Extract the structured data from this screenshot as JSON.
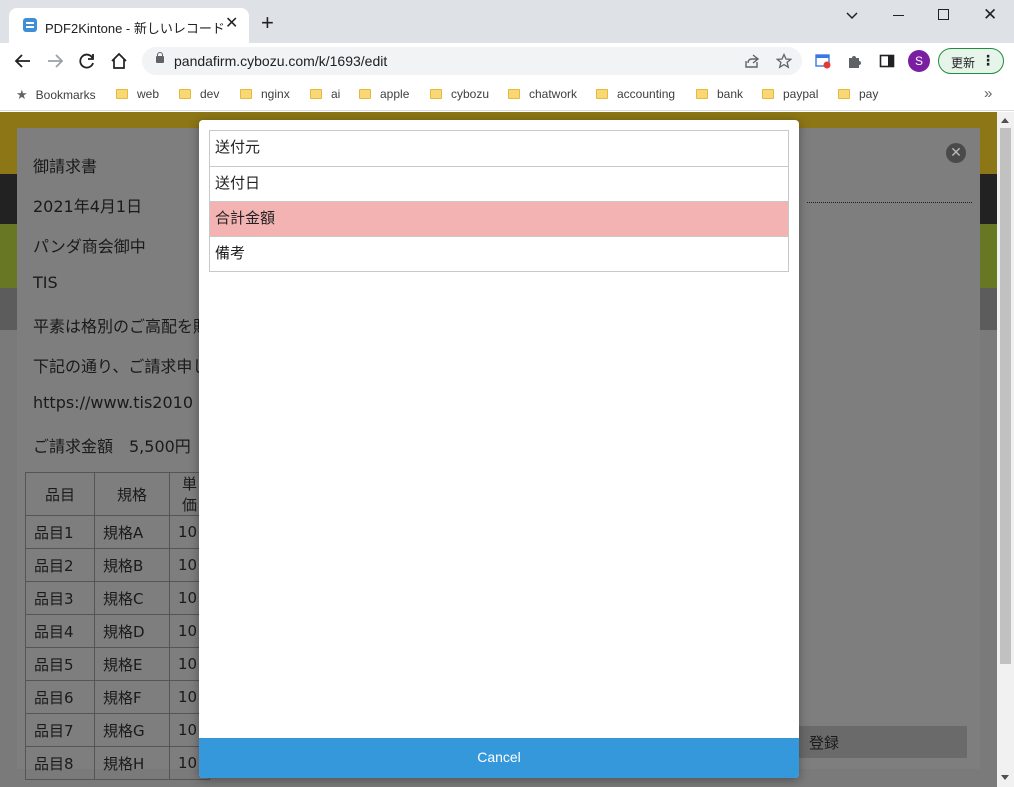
{
  "browser": {
    "tab_title": "PDF2Kintone - 新しいレコード",
    "url": "pandafirm.cybozu.com/k/1693/edit",
    "profile_initial": "S",
    "update_label": "更新",
    "bookmarks_label": "Bookmarks",
    "bookmark_folders": [
      "web",
      "dev",
      "nginx",
      "ai",
      "apple",
      "cybozu",
      "chatwork",
      "accounting",
      "bank",
      "paypal",
      "pay"
    ]
  },
  "background_document": {
    "lines": [
      "御請求書",
      "2021年4月1日",
      "パンダ商会御中",
      "TIS",
      "平素は格別のご高配を賜",
      "下記の通り、ご請求申し",
      "https://www.tis2010",
      "ご請求金額　5,500円"
    ],
    "table_headers": [
      "品目",
      "規格",
      "単価"
    ],
    "table_rows": [
      [
        "品目1",
        "規格A",
        "10"
      ],
      [
        "品目2",
        "規格B",
        "10"
      ],
      [
        "品目3",
        "規格C",
        "10"
      ],
      [
        "品目4",
        "規格D",
        "10"
      ],
      [
        "品目5",
        "規格E",
        "10"
      ],
      [
        "品目6",
        "規格F",
        "10"
      ],
      [
        "品目7",
        "規格G",
        "10"
      ],
      [
        "品目8",
        "規格H",
        "10"
      ]
    ],
    "save_label": "登録"
  },
  "dialog": {
    "fields": [
      "送付元",
      "送付日",
      "合計金額",
      "備考"
    ],
    "selected_index": 2,
    "cancel_label": "Cancel"
  },
  "colors": {
    "selected_row": "#f4b3b3",
    "cancel_button": "#3498db"
  }
}
